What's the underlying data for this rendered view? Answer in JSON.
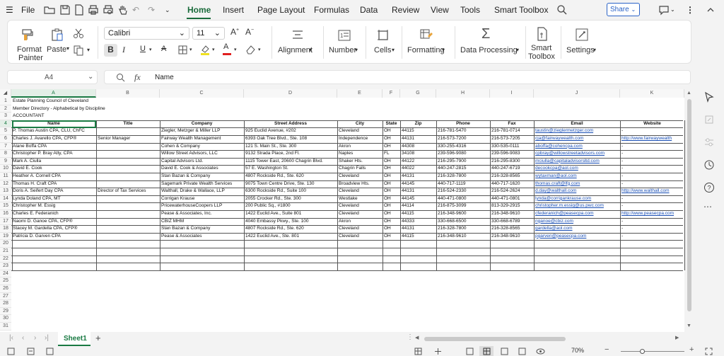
{
  "menu": {
    "file": "File",
    "tabs": [
      "Home",
      "Insert",
      "Page Layout",
      "Formulas",
      "Data",
      "Review",
      "View",
      "Tools",
      "Smart Toolbox"
    ],
    "share": "Share"
  },
  "ribbon": {
    "format_painter": [
      "Format",
      "Painter"
    ],
    "paste": "Paste",
    "font_name": "Calibri",
    "font_size": "11",
    "alignment": "Alignment",
    "number": "Number",
    "cells": "Cells",
    "formatting": "Formatting",
    "data_processing": "Data Processing",
    "smart_toolbox": [
      "Smart",
      "Toolbox"
    ],
    "settings": "Settings"
  },
  "formula_bar": {
    "cell_ref": "A4",
    "fx": "fx",
    "value": "Name"
  },
  "columns": [
    "A",
    "B",
    "C",
    "D",
    "E",
    "F",
    "G",
    "H",
    "I",
    "J",
    "K"
  ],
  "rows": [
    "1",
    "2",
    "3",
    "4",
    "5",
    "6",
    "7",
    "8",
    "9",
    "10",
    "11",
    "12",
    "13",
    "14",
    "15",
    "16",
    "17",
    "18",
    "19",
    "20",
    "21",
    "22",
    "23",
    "24",
    "25",
    "26",
    "27",
    "28",
    "29",
    "30",
    "31"
  ],
  "title_lines": [
    "Estate Planning Council of Cleveland",
    "Member Directory - Alphabetical by Discipline",
    "ACCOUNTANT"
  ],
  "headers": [
    "Name",
    "Title",
    "Company",
    "Street Address",
    "City",
    "State",
    "Zip",
    "Phone",
    "Fax",
    "Email",
    "Website"
  ],
  "records": [
    [
      "P. Thomas Austin CPA, CLU, ChFC",
      "",
      "Ziegler, Metzger & Miller LLP",
      "925 Euclid Avenue, #202",
      "Cleveland",
      "OH",
      "44115",
      "216-781-5470",
      "216-781-0714",
      "taustin@zieglermetzger.com",
      "-"
    ],
    [
      "Charles J. Avarello CPA, CFP®",
      "Senior Manager",
      "Fairway Wealth Management",
      "6393 Oak Tree Blvd., Ste. 108",
      "Independence",
      "OH",
      "44131",
      "216-573-7200",
      "216-573-7205",
      "cja@fairwaywealth.com",
      "http://www.fairwaywealth"
    ],
    [
      "Alane Boffa CPA",
      "",
      "Cohen & Company",
      "121 S. Main St., Ste. 300",
      "Akron",
      "OH",
      "44308",
      "330-255-4316",
      "330-535-0111",
      "aboffa@cohencpa.com",
      "-"
    ],
    [
      "Christopher P. Bray Atty, CPA",
      "",
      "Willow Street Advisors, LLC",
      "9132 Strada Place, 2nd Fl.",
      "Naples",
      "FL",
      "34108",
      "239-596-9080",
      "239-596-9083",
      "cpbray@willowstreetadvisors.com",
      "-"
    ],
    [
      "Mark A. Ciulla",
      "",
      "Capital Advisors Ltd.",
      "1115 Tower East, 20600 Chagrin Blvd.",
      "Shaker Hts.",
      "OH",
      "44122",
      "216-295-7900",
      "216-295-8300",
      "mciulla@capitaladvisorsltd.com",
      "-"
    ],
    [
      "David E. Cook",
      "",
      "David E. Cook & Associates",
      "57 E. Washington St.",
      "Chagrin Falls",
      "OH",
      "44022",
      "440-247-2815",
      "440-247-6719",
      "decookcpa@aol.com",
      "-"
    ],
    [
      "Heather A. Cornell CPA",
      "",
      "Stan Bazan & Company",
      "4807 Rockside Rd., Ste. 620",
      "Cleveland",
      "OH",
      "44131",
      "216-328-7800",
      "216-328-8565",
      "wytaxman@aol.com",
      "-"
    ],
    [
      "Thomas H. Craft CPA",
      "",
      "Sagemark Private Wealth Services",
      "9075 Town Centre Drive, Ste. 130",
      "Broadview Hts.",
      "OH",
      "44145",
      "440-717-1119",
      "440-717-1620",
      "thomas.craft@lfg.com",
      "-"
    ],
    [
      "Doris A. Seifert Day CPA",
      "Director of Tax Services",
      "Walthall, Drake & Wallace, LLP",
      "6300 Rockside Rd., Suite 100",
      "Cleveland",
      "OH",
      "44131",
      "216-524-2330",
      "216-524-2624",
      "d.day@walthall.com",
      "http://www.walthall.com"
    ],
    [
      "Lynda Doland CPA, MT",
      "",
      "Corrigan Krause",
      "2055 Crocker Rd., Ste. 300",
      "Westlake",
      "OH",
      "44145",
      "440-471-0800",
      "440-471-0801",
      "lynda@corrigankrause.com",
      "-"
    ],
    [
      "Christopher M. Essig",
      "",
      "PricewaterhouseCoopers LLP",
      "200 Public Sq., #1800",
      "Cleveland",
      "OH",
      "44114",
      "216-875-3099",
      "813-329-2915",
      "christopher.m.essig@us.pwc.com",
      "-"
    ],
    [
      "Charles E. Federanich",
      "",
      "Pease & Associates, Inc.",
      "1422 Euclid Ave., Suite 801",
      "Cleveland",
      "OH",
      "44115",
      "216-348-9600",
      "216-348-9610",
      "cfederanich@peasecpa.com",
      "http://www.peasecpa.com"
    ],
    [
      "Naomi D. Ganoe CPA, CFP®",
      "",
      "CBIZ MHM",
      "4040 Embassy Pkwy., Ste. 100",
      "Akron",
      "OH",
      "44333",
      "330-668-6500",
      "330-668-6789",
      "nganoe@cbiz.com",
      "-"
    ],
    [
      "Stacey M. Gardella CPA, CFP®",
      "",
      "Stan Bazan & Company",
      "4807 Rockside Rd., Ste. 620",
      "Cleveland",
      "OH",
      "44131",
      "216-328-7800",
      "216-328-8565",
      "gardella@aol.com",
      "-"
    ],
    [
      "Patricia D. Garven CPA",
      "",
      "Pease & Associates",
      "1422 Euclid Ave., Ste. 801",
      "Cleveland",
      "OH",
      "44115",
      "216-348-9610",
      "216-348-9610",
      "pgarven@peasecpa.com",
      "-"
    ]
  ],
  "sheet_tab": "Sheet1",
  "zoom": "70%"
}
